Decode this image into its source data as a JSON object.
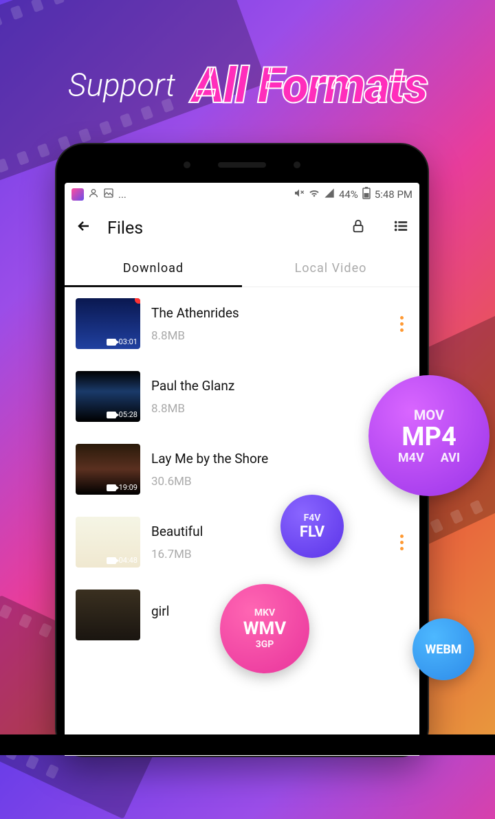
{
  "marketing": {
    "small": "Support",
    "big": "All Formats"
  },
  "status": {
    "battery": "44%",
    "time": "5:48 PM"
  },
  "header": {
    "title": "Files"
  },
  "tabs": [
    {
      "label": "Download",
      "active": true
    },
    {
      "label": "Local Video",
      "active": false
    }
  ],
  "videos": [
    {
      "title": "The Athenrides",
      "size": "8.8MB",
      "duration": "03:01",
      "new": true
    },
    {
      "title": "Paul the Glanz",
      "size": "8.8MB",
      "duration": "05:28",
      "new": false
    },
    {
      "title": "Lay Me by the Shore",
      "size": "30.6MB",
      "duration": "19:09",
      "new": false
    },
    {
      "title": "Beautiful",
      "size": "16.7MB",
      "duration": "04:48",
      "new": false
    },
    {
      "title": "girl",
      "size": "",
      "duration": "",
      "new": false
    }
  ],
  "bubbles": {
    "big": {
      "l1": "MOV",
      "l2": "MP4",
      "l3a": "M4V",
      "l3b": "AVI"
    },
    "flv": {
      "l1": "F4V",
      "l2": "FLV"
    },
    "wmv": {
      "l1": "MKV",
      "l2": "WMV",
      "l3": "3GP"
    },
    "webm": "WEBM"
  }
}
